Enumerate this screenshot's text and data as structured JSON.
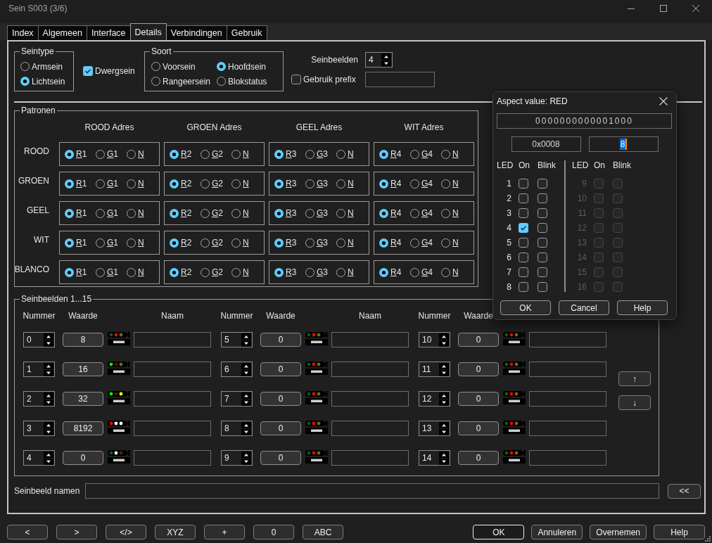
{
  "window": {
    "title": "Sein S003 (3/6)"
  },
  "tabs": [
    {
      "label": "Index",
      "selected": false
    },
    {
      "label": "Algemeen",
      "selected": false
    },
    {
      "label": "Interface",
      "selected": false
    },
    {
      "label": "Details",
      "selected": true
    },
    {
      "label": "Verbindingen",
      "selected": false
    },
    {
      "label": "Gebruik",
      "selected": false
    }
  ],
  "seintype": {
    "title": "Seintype",
    "options": [
      {
        "label": "Armsein",
        "selected": false
      },
      {
        "label": "Lichtsein",
        "selected": true
      }
    ]
  },
  "dwergsein": {
    "label": "Dwergsein",
    "checked": true
  },
  "soort": {
    "title": "Soort",
    "options": [
      {
        "label": "Voorsein",
        "selected": false
      },
      {
        "label": "Hoofdsein",
        "selected": true
      },
      {
        "label": "Rangeersein",
        "selected": false
      },
      {
        "label": "Blokstatus",
        "selected": false
      }
    ]
  },
  "seinbeelden_count": {
    "label": "Seinbeelden",
    "value": "4"
  },
  "gebruik_prefix": {
    "label": "Gebruik prefix",
    "checked": false
  },
  "patronen": {
    "title": "Patronen",
    "columns": [
      "ROOD Adres",
      "GROEN Adres",
      "GEEL Adres",
      "WIT Adres"
    ],
    "rows": [
      {
        "label": "ROOD",
        "cells": [
          {
            "options": [
              {
                "label": "R1",
                "selected": true
              },
              {
                "label": "G1",
                "selected": false
              },
              {
                "label": "N",
                "selected": false
              }
            ]
          },
          {
            "options": [
              {
                "label": "R2",
                "selected": true
              },
              {
                "label": "G2",
                "selected": false
              },
              {
                "label": "N",
                "selected": false
              }
            ]
          },
          {
            "options": [
              {
                "label": "R3",
                "selected": true
              },
              {
                "label": "G3",
                "selected": false
              },
              {
                "label": "N",
                "selected": false
              }
            ]
          },
          {
            "options": [
              {
                "label": "R4",
                "selected": true
              },
              {
                "label": "G4",
                "selected": false
              },
              {
                "label": "N",
                "selected": false
              }
            ]
          }
        ]
      },
      {
        "label": "GROEN",
        "cells": [
          {
            "options": [
              {
                "label": "R1",
                "selected": true
              },
              {
                "label": "G1",
                "selected": false
              },
              {
                "label": "N",
                "selected": false
              }
            ]
          },
          {
            "options": [
              {
                "label": "R2",
                "selected": true
              },
              {
                "label": "G2",
                "selected": false
              },
              {
                "label": "N",
                "selected": false
              }
            ]
          },
          {
            "options": [
              {
                "label": "R3",
                "selected": true
              },
              {
                "label": "G3",
                "selected": false
              },
              {
                "label": "N",
                "selected": false
              }
            ]
          },
          {
            "options": [
              {
                "label": "R4",
                "selected": true
              },
              {
                "label": "G4",
                "selected": false
              },
              {
                "label": "N",
                "selected": false
              }
            ]
          }
        ]
      },
      {
        "label": "GEEL",
        "cells": [
          {
            "options": [
              {
                "label": "R1",
                "selected": true
              },
              {
                "label": "G1",
                "selected": false
              },
              {
                "label": "N",
                "selected": false
              }
            ]
          },
          {
            "options": [
              {
                "label": "R2",
                "selected": true
              },
              {
                "label": "G2",
                "selected": false
              },
              {
                "label": "N",
                "selected": false
              }
            ]
          },
          {
            "options": [
              {
                "label": "R3",
                "selected": true
              },
              {
                "label": "G3",
                "selected": false
              },
              {
                "label": "N",
                "selected": false
              }
            ]
          },
          {
            "options": [
              {
                "label": "R4",
                "selected": true
              },
              {
                "label": "G4",
                "selected": false
              },
              {
                "label": "N",
                "selected": false
              }
            ]
          }
        ]
      },
      {
        "label": "WIT",
        "cells": [
          {
            "options": [
              {
                "label": "R1",
                "selected": true
              },
              {
                "label": "G1",
                "selected": false
              },
              {
                "label": "N",
                "selected": false
              }
            ]
          },
          {
            "options": [
              {
                "label": "R2",
                "selected": true
              },
              {
                "label": "G2",
                "selected": false
              },
              {
                "label": "N",
                "selected": false
              }
            ]
          },
          {
            "options": [
              {
                "label": "R3",
                "selected": true
              },
              {
                "label": "G3",
                "selected": false
              },
              {
                "label": "N",
                "selected": false
              }
            ]
          },
          {
            "options": [
              {
                "label": "R4",
                "selected": true
              },
              {
                "label": "G4",
                "selected": false
              },
              {
                "label": "N",
                "selected": false
              }
            ]
          }
        ]
      },
      {
        "label": "BLANCO",
        "cells": [
          {
            "options": [
              {
                "label": "R1",
                "selected": true
              },
              {
                "label": "G1",
                "selected": false
              },
              {
                "label": "N",
                "selected": false
              }
            ]
          },
          {
            "options": [
              {
                "label": "R2",
                "selected": true
              },
              {
                "label": "G2",
                "selected": false
              },
              {
                "label": "N",
                "selected": false
              }
            ]
          },
          {
            "options": [
              {
                "label": "R3",
                "selected": true
              },
              {
                "label": "G3",
                "selected": false
              },
              {
                "label": "N",
                "selected": false
              }
            ]
          },
          {
            "options": [
              {
                "label": "R4",
                "selected": true
              },
              {
                "label": "G4",
                "selected": false
              },
              {
                "label": "N",
                "selected": false
              }
            ]
          }
        ]
      }
    ]
  },
  "seinbeelden": {
    "title": "Seinbeelden 1...15",
    "columns": [
      {
        "headers": [
          "Nummer",
          "Waarde",
          "Naam"
        ],
        "entries": [
          {
            "number": "0",
            "value": "8",
            "lamps": [
              {
                "color": "#0b5e0b"
              },
              {
                "color": "#ff0000"
              },
              {
                "color": "#6e6a14"
              }
            ]
          },
          {
            "number": "1",
            "value": "16",
            "lamps": [
              {
                "color": "#00ff00"
              },
              {
                "color": "#5e0b0b"
              },
              {
                "color": "#6e6a14"
              }
            ]
          },
          {
            "number": "2",
            "value": "32",
            "lamps": [
              {
                "color": "#00ff00"
              },
              {
                "color": "#5e0b0b"
              },
              {
                "color": "#ffff00"
              }
            ]
          },
          {
            "number": "3",
            "value": "8192",
            "lamps": [
              {
                "color": "#ff0000"
              },
              {
                "color": "#ffffff"
              },
              {
                "color": "#ffffff"
              }
            ]
          },
          {
            "number": "4",
            "value": "0",
            "lamps": [
              {
                "color": "#0b5e0b"
              },
              {
                "color": "#ffffff"
              },
              {
                "color": "#5a1e0a"
              }
            ]
          }
        ]
      },
      {
        "headers": [
          "Nummer",
          "Waarde",
          "Naam"
        ],
        "entries": [
          {
            "number": "5",
            "value": "0",
            "lamps": [
              {
                "color": "#0b5e0b"
              },
              {
                "color": "#ff0000"
              },
              {
                "color": "#6e6a14"
              }
            ]
          },
          {
            "number": "6",
            "value": "0",
            "lamps": [
              {
                "color": "#0b5e0b"
              },
              {
                "color": "#ff0000"
              },
              {
                "color": "#6e6a14"
              }
            ]
          },
          {
            "number": "7",
            "value": "0",
            "lamps": [
              {
                "color": "#0b5e0b"
              },
              {
                "color": "#ff0000"
              },
              {
                "color": "#6e6a14"
              }
            ]
          },
          {
            "number": "8",
            "value": "0",
            "lamps": [
              {
                "color": "#0b5e0b"
              },
              {
                "color": "#ff0000"
              },
              {
                "color": "#6e6a14"
              }
            ]
          },
          {
            "number": "9",
            "value": "0",
            "lamps": [
              {
                "color": "#0b5e0b"
              },
              {
                "color": "#ff0000"
              },
              {
                "color": "#6e6a14"
              }
            ]
          }
        ]
      },
      {
        "headers": [
          "Nummer",
          "Waarde"
        ],
        "entries": [
          {
            "number": "10",
            "value": "0",
            "lamps": [
              {
                "color": "#0b5e0b"
              },
              {
                "color": "#ff0000"
              },
              {
                "color": "#6e6a14"
              }
            ]
          },
          {
            "number": "11",
            "value": "0",
            "lamps": [
              {
                "color": "#0b5e0b"
              },
              {
                "color": "#ff0000"
              },
              {
                "color": "#6e6a14"
              }
            ]
          },
          {
            "number": "12",
            "value": "0",
            "lamps": [
              {
                "color": "#0b5e0b"
              },
              {
                "color": "#ff0000"
              },
              {
                "color": "#6e6a14"
              }
            ]
          },
          {
            "number": "13",
            "value": "0",
            "lamps": [
              {
                "color": "#0b5e0b"
              },
              {
                "color": "#ff0000"
              },
              {
                "color": "#6e6a14"
              }
            ]
          },
          {
            "number": "14",
            "value": "0",
            "lamps": [
              {
                "color": "#0b5e0b"
              },
              {
                "color": "#ff0000"
              },
              {
                "color": "#6e6a14"
              }
            ]
          }
        ]
      }
    ],
    "move_buttons": [
      "↑",
      "↓"
    ]
  },
  "seinbeeld_namen": {
    "label": "Seinbeeld namen",
    "button": "<<"
  },
  "toolbar_buttons": [
    "<",
    ">",
    "</>",
    "XYZ",
    "+",
    "0",
    "ABC"
  ],
  "dialog_buttons": [
    {
      "label": "OK",
      "default": true
    },
    {
      "label": "Annuleren",
      "default": false
    },
    {
      "label": "Overnemen",
      "default": false
    },
    {
      "label": "Help",
      "default": false
    }
  ],
  "aspect_dialog": {
    "title": "Aspect value: RED",
    "binary": "0000000000001000",
    "hex": "0x0008",
    "decimal": {
      "value": "8",
      "text_selected": true
    },
    "led_groups": [
      {
        "headers": [
          "LED",
          "On",
          "Blink"
        ],
        "leds": [
          {
            "number": "1",
            "on": false,
            "blink": false,
            "disabled": false
          },
          {
            "number": "2",
            "on": false,
            "blink": false,
            "disabled": false
          },
          {
            "number": "3",
            "on": false,
            "blink": false,
            "disabled": false
          },
          {
            "number": "4",
            "on": true,
            "blink": false,
            "disabled": false
          },
          {
            "number": "5",
            "on": false,
            "blink": false,
            "disabled": false
          },
          {
            "number": "6",
            "on": false,
            "blink": false,
            "disabled": false
          },
          {
            "number": "7",
            "on": false,
            "blink": false,
            "disabled": false
          },
          {
            "number": "8",
            "on": false,
            "blink": false,
            "disabled": false
          }
        ]
      },
      {
        "headers": [
          "LED",
          "On",
          "Blink"
        ],
        "leds": [
          {
            "number": "9",
            "on": false,
            "blink": false,
            "disabled": true
          },
          {
            "number": "10",
            "on": false,
            "blink": false,
            "disabled": true
          },
          {
            "number": "11",
            "on": false,
            "blink": false,
            "disabled": true
          },
          {
            "number": "12",
            "on": false,
            "blink": false,
            "disabled": true
          },
          {
            "number": "13",
            "on": false,
            "blink": false,
            "disabled": true
          },
          {
            "number": "14",
            "on": false,
            "blink": false,
            "disabled": true
          },
          {
            "number": "15",
            "on": false,
            "blink": false,
            "disabled": true
          },
          {
            "number": "16",
            "on": false,
            "blink": false,
            "disabled": true
          }
        ]
      }
    ],
    "buttons": [
      "OK",
      "Cancel",
      "Help"
    ]
  }
}
